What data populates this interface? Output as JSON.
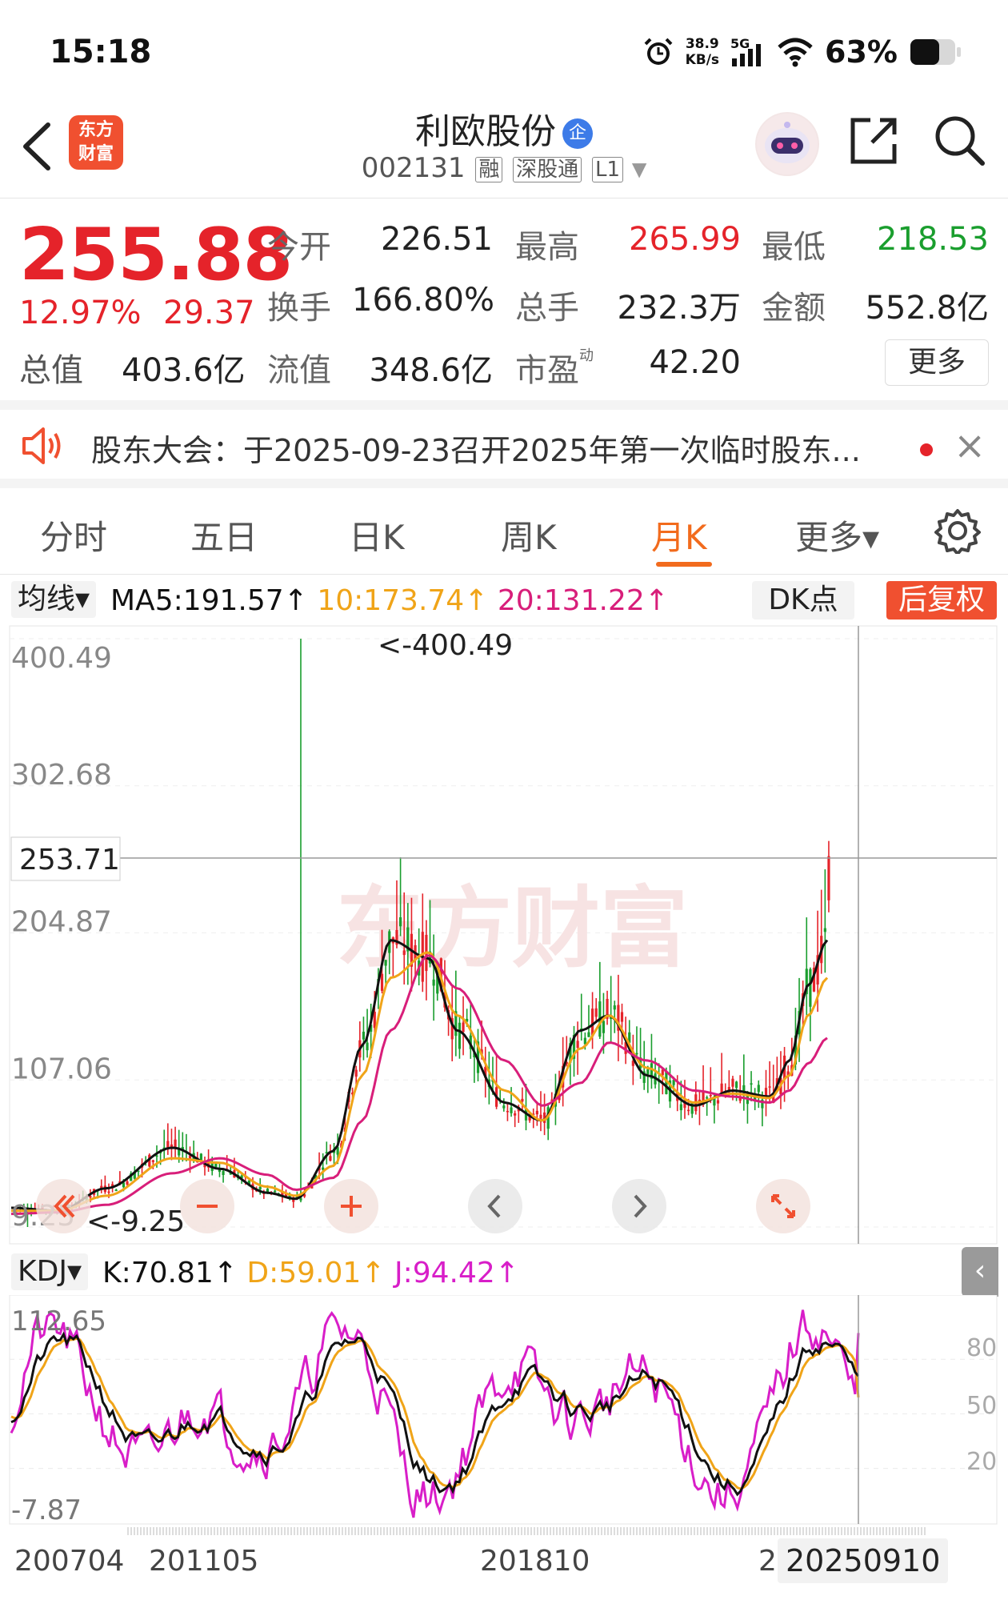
{
  "status": {
    "time": "15:18",
    "net_speed_value": "38.9",
    "net_speed_unit": "KB/s",
    "network": "5G",
    "battery": "63%"
  },
  "header": {
    "logo_line1": "东方",
    "logo_line2": "财富",
    "stock_name": "利欧股份",
    "badge": "企",
    "stock_code": "002131",
    "tags": [
      "融",
      "深股通",
      "L1"
    ]
  },
  "quote": {
    "price": "255.88",
    "change_pct": "12.97%",
    "change_abs": "29.37",
    "open_label": "今开",
    "open": "226.51",
    "high_label": "最高",
    "high": "265.99",
    "low_label": "最低",
    "low": "218.53",
    "turnover_label": "换手",
    "turnover": "166.80%",
    "volume_label": "总手",
    "volume": "232.3万",
    "amount_label": "金额",
    "amount": "552.8亿",
    "total_value_label": "总值",
    "total_value": "403.6亿",
    "float_value_label": "流值",
    "float_value": "348.6亿",
    "pe_label": "市盈",
    "pe_sup": "动",
    "pe": "42.20",
    "more_label": "更多"
  },
  "notice": {
    "text": "股东大会：于2025-09-23召开2025年第一次临时股东...",
    "close": "×"
  },
  "tabs": {
    "items": [
      "分时",
      "五日",
      "日K",
      "周K",
      "月K",
      "更多▾"
    ],
    "active_index": 4
  },
  "ma": {
    "toggle": "均线▾",
    "ma5": "MA5:191.57↑",
    "ma10": "10:173.74↑",
    "ma20": "20:131.22↑",
    "dk_label": "DK点",
    "restore_label": "后复权",
    "colors": {
      "ma5": "#111111",
      "ma10": "#f0a418",
      "ma20": "#d81e7a",
      "up": "#e5232a",
      "down": "#1a9e2e"
    }
  },
  "kdj": {
    "toggle": "KDJ▾",
    "k": "K:70.81↑",
    "d": "D:59.01↑",
    "j": "J:94.42↑",
    "collapse": "‹"
  },
  "chart_data": [
    {
      "type": "candlestick",
      "period": "monthly",
      "y_ticks": [
        "400.49",
        "302.68",
        "204.87",
        "107.06",
        "9.25"
      ],
      "ylim": [
        9.25,
        400.49
      ],
      "crosshair_value": "253.71",
      "max_annotation": "<-400.49",
      "min_annotation": "<-9.25",
      "x_ticks": [
        "200704",
        "201105",
        "201810",
        "2",
        "20250910"
      ],
      "watermark": "东方财富",
      "ma_series": [
        {
          "name": "MA5",
          "anchors": [
            [
              0,
              22
            ],
            [
              0.05,
              20
            ],
            [
              0.1,
              35
            ],
            [
              0.17,
              62
            ],
            [
              0.22,
              48
            ],
            [
              0.27,
              32
            ],
            [
              0.3,
              28
            ],
            [
              0.34,
              60
            ],
            [
              0.37,
              130
            ],
            [
              0.4,
              200
            ],
            [
              0.44,
              188
            ],
            [
              0.47,
              140
            ],
            [
              0.52,
              92
            ],
            [
              0.56,
              80
            ],
            [
              0.6,
              140
            ],
            [
              0.63,
              150
            ],
            [
              0.67,
              110
            ],
            [
              0.72,
              90
            ],
            [
              0.76,
              100
            ],
            [
              0.8,
              96
            ],
            [
              0.82,
              120
            ],
            [
              0.84,
              170
            ],
            [
              0.86,
              200
            ]
          ]
        },
        {
          "name": "MA10",
          "anchors": [
            [
              0,
              20
            ],
            [
              0.05,
              20
            ],
            [
              0.1,
              30
            ],
            [
              0.17,
              55
            ],
            [
              0.22,
              52
            ],
            [
              0.27,
              36
            ],
            [
              0.3,
              30
            ],
            [
              0.34,
              50
            ],
            [
              0.37,
              110
            ],
            [
              0.4,
              175
            ],
            [
              0.44,
              192
            ],
            [
              0.47,
              150
            ],
            [
              0.52,
              100
            ],
            [
              0.56,
              80
            ],
            [
              0.6,
              128
            ],
            [
              0.63,
              150
            ],
            [
              0.67,
              115
            ],
            [
              0.72,
              92
            ],
            [
              0.76,
              98
            ],
            [
              0.8,
              95
            ],
            [
              0.82,
              110
            ],
            [
              0.84,
              150
            ],
            [
              0.86,
              175
            ]
          ]
        },
        {
          "name": "MA20",
          "anchors": [
            [
              0,
              18
            ],
            [
              0.05,
              19
            ],
            [
              0.1,
              24
            ],
            [
              0.17,
              45
            ],
            [
              0.22,
              55
            ],
            [
              0.27,
              44
            ],
            [
              0.3,
              34
            ],
            [
              0.34,
              42
            ],
            [
              0.37,
              80
            ],
            [
              0.4,
              140
            ],
            [
              0.44,
              190
            ],
            [
              0.47,
              168
            ],
            [
              0.52,
              120
            ],
            [
              0.56,
              90
            ],
            [
              0.6,
              105
            ],
            [
              0.63,
              132
            ],
            [
              0.67,
              120
            ],
            [
              0.72,
              100
            ],
            [
              0.76,
              96
            ],
            [
              0.8,
              92
            ],
            [
              0.82,
              100
            ],
            [
              0.84,
              118
            ],
            [
              0.86,
              135
            ]
          ]
        }
      ]
    },
    {
      "type": "line",
      "indicator": "KDJ",
      "y_ticks_left": [
        "112.65",
        "-7.87"
      ],
      "y_ticks_right": [
        "80",
        "50",
        "20"
      ],
      "ylim": [
        -7.87,
        112.65
      ]
    }
  ],
  "controls": {
    "icons": [
      "fast-back-icon",
      "zoom-out-icon",
      "zoom-in-icon",
      "prev-icon",
      "next-icon",
      "expand-icon"
    ]
  }
}
